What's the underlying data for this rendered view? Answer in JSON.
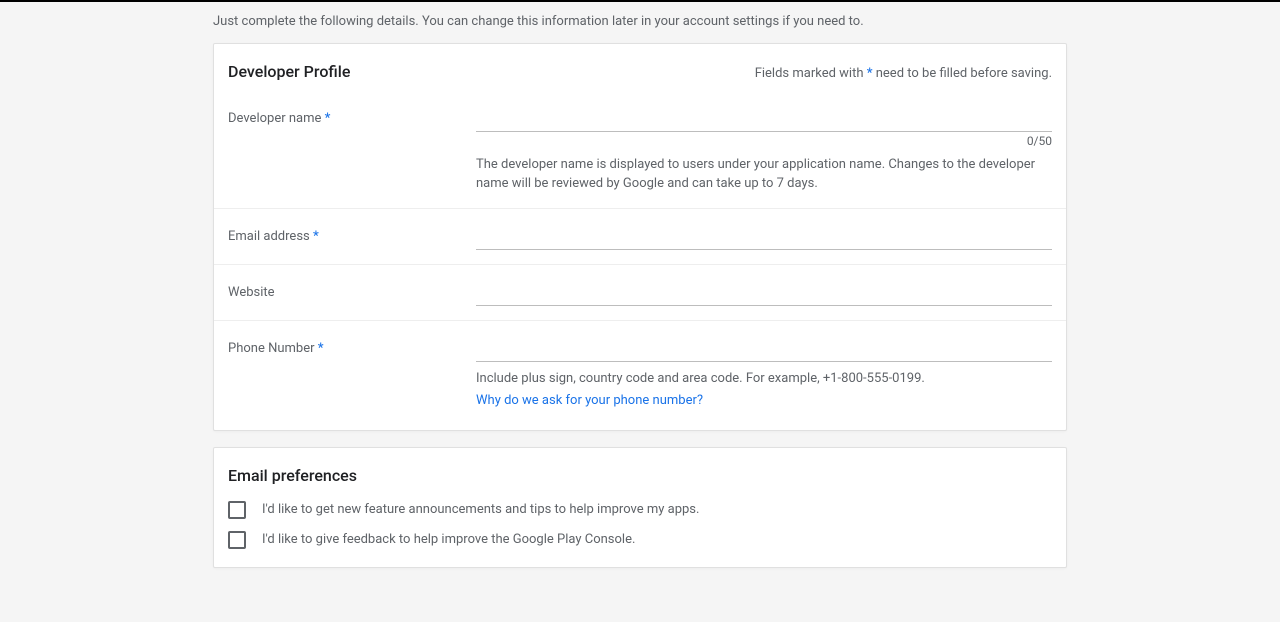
{
  "intro": "Just complete the following details. You can change this information later in your account settings if you need to.",
  "profile": {
    "title": "Developer Profile",
    "required_note_prefix": "Fields marked with",
    "required_note_suffix": "need to be filled before saving.",
    "asterisk": "*",
    "fields": {
      "developer_name": {
        "label": "Developer name",
        "required": true,
        "value": "",
        "counter": "0/50",
        "helper": "The developer name is displayed to users under your application name. Changes to the developer name will be reviewed by Google and can take up to 7 days."
      },
      "email": {
        "label": "Email address",
        "required": true,
        "value": ""
      },
      "website": {
        "label": "Website",
        "required": false,
        "value": ""
      },
      "phone": {
        "label": "Phone Number",
        "required": true,
        "value": "",
        "helper": "Include plus sign, country code and area code. For example, +1-800-555-0199.",
        "link_text": "Why do we ask for your phone number?"
      }
    }
  },
  "email_prefs": {
    "title": "Email preferences",
    "options": [
      "I'd like to get new feature announcements and tips to help improve my apps.",
      "I'd like to give feedback to help improve the Google Play Console."
    ]
  }
}
